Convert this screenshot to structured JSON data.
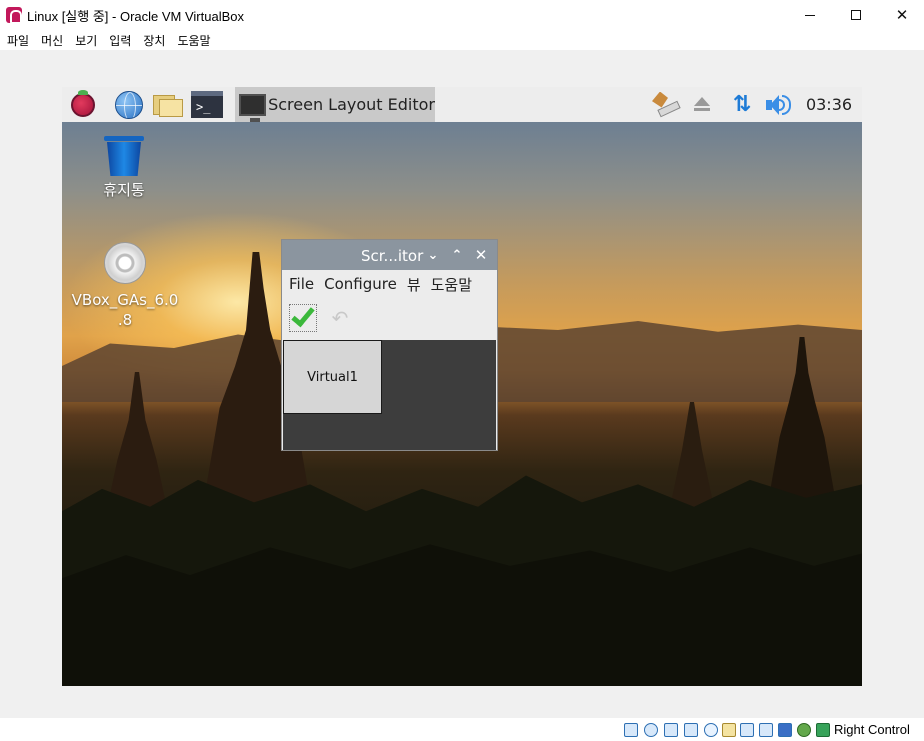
{
  "window": {
    "title": "Linux [실행 중] - Oracle VM VirtualBox",
    "icon": "virtualbox-icon",
    "controls": {
      "minimize": "minimize-icon",
      "maximize": "maximize-icon",
      "close": "✕"
    }
  },
  "menubar": [
    "파일",
    "머신",
    "보기",
    "입력",
    "장치",
    "도움말"
  ],
  "guest": {
    "panel": {
      "launchers": [
        "raspberry-pi-menu-icon",
        "web-browser-icon",
        "file-manager-icon",
        "terminal-icon"
      ],
      "terminal_glyph": ">_",
      "task_label": "Screen Layout Editor",
      "tray": {
        "usb": "usb-eject-icon",
        "eject": "eject-icon",
        "network": "⇅",
        "volume": "volume-icon",
        "clock": "03:36"
      }
    },
    "desktop": {
      "trash_label": "휴지통",
      "cd_label_line1": "VBox_GAs_6.0",
      "cd_label_line2": ".8"
    },
    "dialog": {
      "title": "Scr...itor",
      "title_buttons": {
        "minimize": "⌄",
        "maximize": "⌃",
        "close": "✕"
      },
      "menu": [
        "File",
        "Configure",
        "뷰",
        "도움말"
      ],
      "toolbar": {
        "apply": "apply-check-icon",
        "undo": "↶"
      },
      "monitor_label": "Virtual1"
    }
  },
  "statusbar": {
    "icons": [
      "hard-disk-icon",
      "optical-drive-icon",
      "audio-icon",
      "network-icon",
      "usb-icon",
      "shared-folders-icon",
      "display-icon",
      "recording-icon",
      "vt-x-icon",
      "mouse-capture-icon",
      "keyboard-capture-icon"
    ],
    "host_key": "Right Control"
  },
  "colors": {
    "panel_bg": "#ededed",
    "task_active_bg": "#c9c9c9",
    "dialog_title_bg": "#8b959f",
    "canvas_bg": "#3d3d3d",
    "accent_blue": "#1e7bd6",
    "check_green": "#3bb83b"
  }
}
